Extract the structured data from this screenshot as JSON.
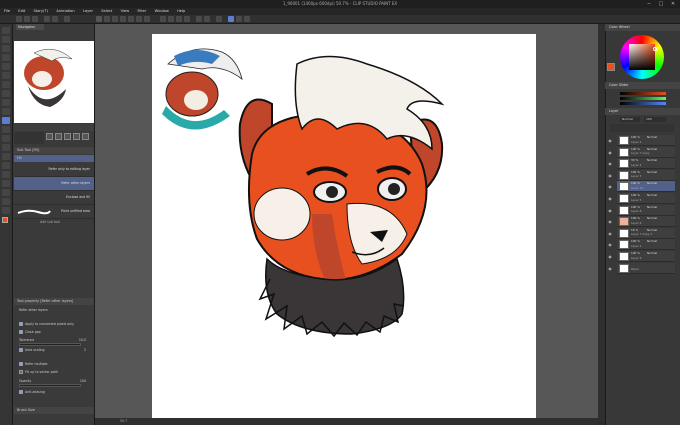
{
  "window": {
    "title": "1_90001 (1400px 600dpi) 50.7% - CLIP STUDIO PAINT EX",
    "controls": [
      "─",
      "□",
      "✕"
    ]
  },
  "menu": [
    "File",
    "Edit",
    "Story(T)",
    "Animation",
    "Layer",
    "Select",
    "View",
    "Filter",
    "Window",
    "Help"
  ],
  "navigator": {
    "tab": "Navigator"
  },
  "subtool": {
    "header": "Sub Tool [Fill]",
    "group": "Fill",
    "items": [
      "Refer only to editing layer",
      "Refer other layers",
      "Enclose and fill",
      "Paint unfilled area"
    ],
    "add_label": "Add sub tool",
    "props_header": "Tool property [Refer other layers]",
    "props_title": "Refer other layers",
    "props": [
      {
        "label": "Apply to connected pixels only",
        "checked": true
      },
      {
        "label": "Close gap",
        "checked": true
      },
      {
        "label": "Tolerance",
        "value": "10.0"
      },
      {
        "label": "Area scaling",
        "checked": true,
        "value": "2"
      },
      {
        "label": "Refer multiple",
        "checked": true
      },
      {
        "label": "Fill up to vector path",
        "checked": false
      },
      {
        "label": "Opacity",
        "value": "100"
      },
      {
        "label": "Anti-aliasing",
        "checked": true
      }
    ],
    "bottom_tab": "Brush Size"
  },
  "color_panel": {
    "tab": "Color Wheel",
    "current": "#e85020",
    "secondary": "#ffffff"
  },
  "color_slider": {
    "tab": "Color Slider"
  },
  "layers": {
    "tab": "Layer",
    "blend": "Normal",
    "opacity": "100",
    "items": [
      {
        "pct": "100 %",
        "mode": "Normal",
        "name": "Layer 2",
        "thumb": "#ffffff",
        "selected": false
      },
      {
        "pct": "100 %",
        "mode": "Normal",
        "name": "Layer 7 Copy",
        "thumb": "#ffffff",
        "selected": false
      },
      {
        "pct": "30 %",
        "mode": "Normal",
        "name": "Layer 4",
        "thumb": "#ffffff",
        "selected": false
      },
      {
        "pct": "100 %",
        "mode": "Normal",
        "name": "Layer 3",
        "thumb": "#ffffff",
        "selected": false
      },
      {
        "pct": "100 %",
        "mode": "Normal",
        "name": "Layer 11",
        "thumb": "#ffffff",
        "selected": true
      },
      {
        "pct": "100 %",
        "mode": "Normal",
        "name": "Layer 5",
        "thumb": "#ffffff",
        "selected": false
      },
      {
        "pct": "100 %",
        "mode": "Normal",
        "name": "Layer 8",
        "thumb": "#ffffff",
        "selected": false
      },
      {
        "pct": "100 %",
        "mode": "Normal",
        "name": "Layer 6",
        "thumb": "#f0b0a0",
        "selected": false
      },
      {
        "pct": "16 %",
        "mode": "Normal",
        "name": "Layer 7 Copy 2",
        "thumb": "#ffffff",
        "selected": false
      },
      {
        "pct": "100 %",
        "mode": "Normal",
        "name": "Layer 1",
        "thumb": "#ffffff",
        "selected": false
      },
      {
        "pct": "100 %",
        "mode": "Normal",
        "name": "Layer 9",
        "thumb": "#ffffff",
        "selected": false
      },
      {
        "pct": "",
        "mode": "",
        "name": "Paper",
        "thumb": "#ffffff",
        "selected": false
      }
    ]
  },
  "statusbar": {
    "zoom": "50.7"
  }
}
